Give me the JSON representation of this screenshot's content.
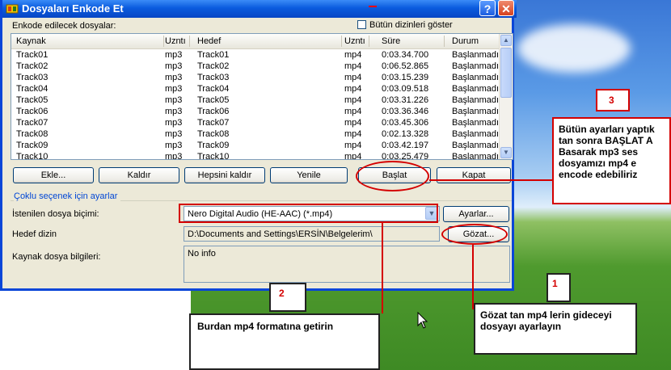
{
  "window": {
    "title": "Dosyaları Enkode Et",
    "help_glyph": "?",
    "close_glyph": "✕"
  },
  "files_section": {
    "label": "Enkode edilecek dosyalar:",
    "show_all_dirs_label": "Bütün dizinleri göster"
  },
  "table": {
    "headers": [
      "Kaynak",
      "Uzntı",
      "Hedef",
      "Uzntı",
      "Süre",
      "Durum"
    ],
    "rows": [
      [
        "Track01",
        "mp3",
        "Track01",
        "mp4",
        "0:03.34.700",
        "Başlanmadı"
      ],
      [
        "Track02",
        "mp3",
        "Track02",
        "mp4",
        "0:06.52.865",
        "Başlanmadı"
      ],
      [
        "Track03",
        "mp3",
        "Track03",
        "mp4",
        "0:03.15.239",
        "Başlanmadı"
      ],
      [
        "Track04",
        "mp3",
        "Track04",
        "mp4",
        "0:03.09.518",
        "Başlanmadı"
      ],
      [
        "Track05",
        "mp3",
        "Track05",
        "mp4",
        "0:03.31.226",
        "Başlanmadı"
      ],
      [
        "Track06",
        "mp3",
        "Track06",
        "mp4",
        "0:03.36.346",
        "Başlanmadı"
      ],
      [
        "Track07",
        "mp3",
        "Track07",
        "mp4",
        "0:03.45.306",
        "Başlanmadı"
      ],
      [
        "Track08",
        "mp3",
        "Track08",
        "mp4",
        "0:02.13.328",
        "Başlanmadı"
      ],
      [
        "Track09",
        "mp3",
        "Track09",
        "mp4",
        "0:03.42.197",
        "Başlanmadı"
      ],
      [
        "Track10",
        "mp3",
        "Track10",
        "mp4",
        "0:03.25.479",
        "Başlanmadı"
      ]
    ]
  },
  "buttons": {
    "add": "Ekle...",
    "remove": "Kaldır",
    "remove_all": "Hepsini kaldır",
    "refresh": "Yenile",
    "start": "Başlat",
    "close": "Kapat",
    "settings": "Ayarlar...",
    "browse": "Gözat..."
  },
  "settings_group": {
    "title": "Çoklu seçenek için ayarlar",
    "format_label": "İstenilen dosya biçimi:",
    "format_value": "Nero Digital Audio (HE-AAC) (*.mp4)",
    "dest_label": "Hedef dizin",
    "dest_value": "D:\\Documents and Settings\\ERSİN\\Belgelerim\\",
    "source_info_label": "Kaynak dosya bilgileri:",
    "source_info_value": "No info"
  },
  "annotations": {
    "n1": "1",
    "n2": "2",
    "n3": "3",
    "note1": "Gözat tan mp4 lerin gideceyi dosyayı ayarlayın",
    "note2": "Burdan mp4 formatına getirin",
    "note3": "Bütün ayarları yaptık tan sonra  BAŞLAT A Basarak mp3 ses dosyamızı mp4 e encode edebiliriz"
  },
  "colors": {
    "titlebar": "#0a5bde",
    "window_bg": "#ece9d8",
    "annotation_red": "#d40000",
    "group_title": "#0046d5"
  }
}
